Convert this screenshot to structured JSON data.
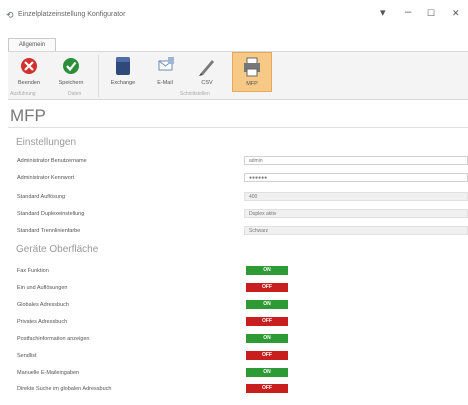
{
  "window": {
    "title": "Einzelplatzeinstellung Konfigurator",
    "minimize_glyph": "–",
    "restore_glyph": "☐",
    "close_glyph": "✕",
    "menu_glyph": "▾"
  },
  "ribbon": {
    "tab": "Allgemein",
    "buttons": [
      {
        "label": "Beenden",
        "icon": "close-circle-icon",
        "color": "#d22f2f"
      },
      {
        "label": "Speichern",
        "icon": "check-circle-icon",
        "color": "#2b8f3a"
      },
      {
        "label": "Exchange",
        "icon": "server-icon",
        "color": "#2f4a7a"
      },
      {
        "label": "E-Mail",
        "icon": "envelope-icon",
        "color": "#6c8db5"
      },
      {
        "label": "CSV",
        "icon": "pen-icon",
        "color": "#6a6a6a"
      },
      {
        "label": "MFP",
        "icon": "printer-icon",
        "color": "#5a5a5a"
      }
    ],
    "groups": [
      "Ausführung",
      "Daten",
      "Schnittstellen"
    ]
  },
  "page": {
    "title": "MFP"
  },
  "settings": {
    "title": "Einstellungen",
    "rows": [
      {
        "label": "Administrator Benutzername",
        "value": "admin",
        "readonly": false
      },
      {
        "label": "Administrator Kennwort",
        "value": "●●●●●●",
        "readonly": false
      },
      {
        "label": "Standard Auflösung",
        "value": "400",
        "readonly": true
      },
      {
        "label": "Standard Duplexeinstellung",
        "value": "Duplex aktiv",
        "readonly": true
      },
      {
        "label": "Standard Trennlinienfarbe",
        "value": "Schwarz",
        "readonly": true
      }
    ]
  },
  "ui": {
    "title": "Geräte Oberfläche",
    "rows": [
      {
        "label": "Fax Funktion",
        "state": "ON"
      },
      {
        "label": "Ein und Auflösungen",
        "state": "OFF"
      },
      {
        "label": "Globales Adressbuch",
        "state": "ON"
      },
      {
        "label": "Privates Adressbuch",
        "state": "OFF"
      },
      {
        "label": "Postfachinformation anzeigen",
        "state": "ON"
      },
      {
        "label": "Sendlist",
        "state": "OFF"
      },
      {
        "label": "Manuelle E-Maileingaben",
        "state": "ON"
      },
      {
        "label": "Direkte Suche im globalen Adressbuch",
        "state": "OFF"
      }
    ]
  },
  "colors": {
    "on": "#2e9a36",
    "off": "#c81e1e",
    "active_ribbon": "#f7c987"
  }
}
